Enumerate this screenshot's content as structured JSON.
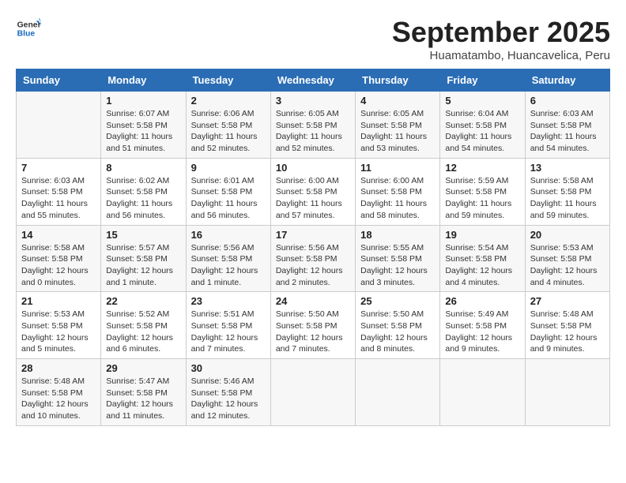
{
  "logo": {
    "line1": "General",
    "line2": "Blue"
  },
  "title": "September 2025",
  "subtitle": "Huamatambo, Huancavelica, Peru",
  "days_of_week": [
    "Sunday",
    "Monday",
    "Tuesday",
    "Wednesday",
    "Thursday",
    "Friday",
    "Saturday"
  ],
  "weeks": [
    [
      {
        "day": "",
        "info": ""
      },
      {
        "day": "1",
        "info": "Sunrise: 6:07 AM\nSunset: 5:58 PM\nDaylight: 11 hours\nand 51 minutes."
      },
      {
        "day": "2",
        "info": "Sunrise: 6:06 AM\nSunset: 5:58 PM\nDaylight: 11 hours\nand 52 minutes."
      },
      {
        "day": "3",
        "info": "Sunrise: 6:05 AM\nSunset: 5:58 PM\nDaylight: 11 hours\nand 52 minutes."
      },
      {
        "day": "4",
        "info": "Sunrise: 6:05 AM\nSunset: 5:58 PM\nDaylight: 11 hours\nand 53 minutes."
      },
      {
        "day": "5",
        "info": "Sunrise: 6:04 AM\nSunset: 5:58 PM\nDaylight: 11 hours\nand 54 minutes."
      },
      {
        "day": "6",
        "info": "Sunrise: 6:03 AM\nSunset: 5:58 PM\nDaylight: 11 hours\nand 54 minutes."
      }
    ],
    [
      {
        "day": "7",
        "info": "Sunrise: 6:03 AM\nSunset: 5:58 PM\nDaylight: 11 hours\nand 55 minutes."
      },
      {
        "day": "8",
        "info": "Sunrise: 6:02 AM\nSunset: 5:58 PM\nDaylight: 11 hours\nand 56 minutes."
      },
      {
        "day": "9",
        "info": "Sunrise: 6:01 AM\nSunset: 5:58 PM\nDaylight: 11 hours\nand 56 minutes."
      },
      {
        "day": "10",
        "info": "Sunrise: 6:00 AM\nSunset: 5:58 PM\nDaylight: 11 hours\nand 57 minutes."
      },
      {
        "day": "11",
        "info": "Sunrise: 6:00 AM\nSunset: 5:58 PM\nDaylight: 11 hours\nand 58 minutes."
      },
      {
        "day": "12",
        "info": "Sunrise: 5:59 AM\nSunset: 5:58 PM\nDaylight: 11 hours\nand 59 minutes."
      },
      {
        "day": "13",
        "info": "Sunrise: 5:58 AM\nSunset: 5:58 PM\nDaylight: 11 hours\nand 59 minutes."
      }
    ],
    [
      {
        "day": "14",
        "info": "Sunrise: 5:58 AM\nSunset: 5:58 PM\nDaylight: 12 hours\nand 0 minutes."
      },
      {
        "day": "15",
        "info": "Sunrise: 5:57 AM\nSunset: 5:58 PM\nDaylight: 12 hours\nand 1 minute."
      },
      {
        "day": "16",
        "info": "Sunrise: 5:56 AM\nSunset: 5:58 PM\nDaylight: 12 hours\nand 1 minute."
      },
      {
        "day": "17",
        "info": "Sunrise: 5:56 AM\nSunset: 5:58 PM\nDaylight: 12 hours\nand 2 minutes."
      },
      {
        "day": "18",
        "info": "Sunrise: 5:55 AM\nSunset: 5:58 PM\nDaylight: 12 hours\nand 3 minutes."
      },
      {
        "day": "19",
        "info": "Sunrise: 5:54 AM\nSunset: 5:58 PM\nDaylight: 12 hours\nand 4 minutes."
      },
      {
        "day": "20",
        "info": "Sunrise: 5:53 AM\nSunset: 5:58 PM\nDaylight: 12 hours\nand 4 minutes."
      }
    ],
    [
      {
        "day": "21",
        "info": "Sunrise: 5:53 AM\nSunset: 5:58 PM\nDaylight: 12 hours\nand 5 minutes."
      },
      {
        "day": "22",
        "info": "Sunrise: 5:52 AM\nSunset: 5:58 PM\nDaylight: 12 hours\nand 6 minutes."
      },
      {
        "day": "23",
        "info": "Sunrise: 5:51 AM\nSunset: 5:58 PM\nDaylight: 12 hours\nand 7 minutes."
      },
      {
        "day": "24",
        "info": "Sunrise: 5:50 AM\nSunset: 5:58 PM\nDaylight: 12 hours\nand 7 minutes."
      },
      {
        "day": "25",
        "info": "Sunrise: 5:50 AM\nSunset: 5:58 PM\nDaylight: 12 hours\nand 8 minutes."
      },
      {
        "day": "26",
        "info": "Sunrise: 5:49 AM\nSunset: 5:58 PM\nDaylight: 12 hours\nand 9 minutes."
      },
      {
        "day": "27",
        "info": "Sunrise: 5:48 AM\nSunset: 5:58 PM\nDaylight: 12 hours\nand 9 minutes."
      }
    ],
    [
      {
        "day": "28",
        "info": "Sunrise: 5:48 AM\nSunset: 5:58 PM\nDaylight: 12 hours\nand 10 minutes."
      },
      {
        "day": "29",
        "info": "Sunrise: 5:47 AM\nSunset: 5:58 PM\nDaylight: 12 hours\nand 11 minutes."
      },
      {
        "day": "30",
        "info": "Sunrise: 5:46 AM\nSunset: 5:58 PM\nDaylight: 12 hours\nand 12 minutes."
      },
      {
        "day": "",
        "info": ""
      },
      {
        "day": "",
        "info": ""
      },
      {
        "day": "",
        "info": ""
      },
      {
        "day": "",
        "info": ""
      }
    ]
  ]
}
